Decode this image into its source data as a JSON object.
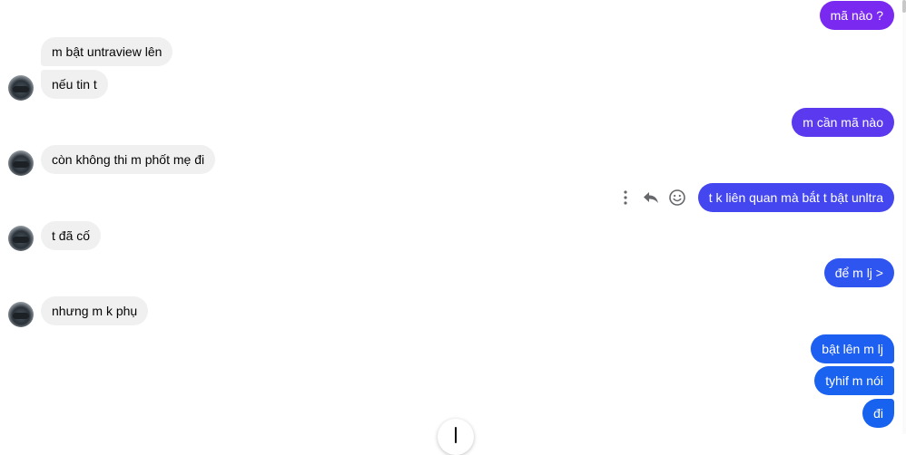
{
  "colors": {
    "incoming_bg": "#f0f0f0",
    "outgoing_purple": "#7a2af0",
    "outgoing_violet": "#5a39ee",
    "outgoing_blue": "#2f55f0",
    "outgoing_deep_blue": "#1763f0"
  },
  "messages": [
    {
      "side": "outgoing",
      "text": "mã nào ?"
    },
    {
      "side": "incoming",
      "text": "m bật untraview lên"
    },
    {
      "side": "incoming",
      "text": "nếu tin t"
    },
    {
      "side": "outgoing",
      "text": "m cần mã nào"
    },
    {
      "side": "incoming",
      "text": "còn không thi m phốt mẹ đi"
    },
    {
      "side": "outgoing",
      "text": "t k liên quan mà bắt t bật unltra"
    },
    {
      "side": "incoming",
      "text": "t đã cố"
    },
    {
      "side": "outgoing",
      "text": "để m lj >"
    },
    {
      "side": "incoming",
      "text": "nhưng m k phụ"
    },
    {
      "side": "outgoing",
      "text": "bật lên m lj"
    },
    {
      "side": "outgoing",
      "text": "tyhif m nói"
    },
    {
      "side": "outgoing",
      "text": "đi"
    }
  ],
  "hover_actions": {
    "more_icon": "more-vertical-icon",
    "reply_icon": "reply-icon",
    "react_icon": "smiley-icon"
  },
  "scroll_button_icon": "arrow-down-icon"
}
